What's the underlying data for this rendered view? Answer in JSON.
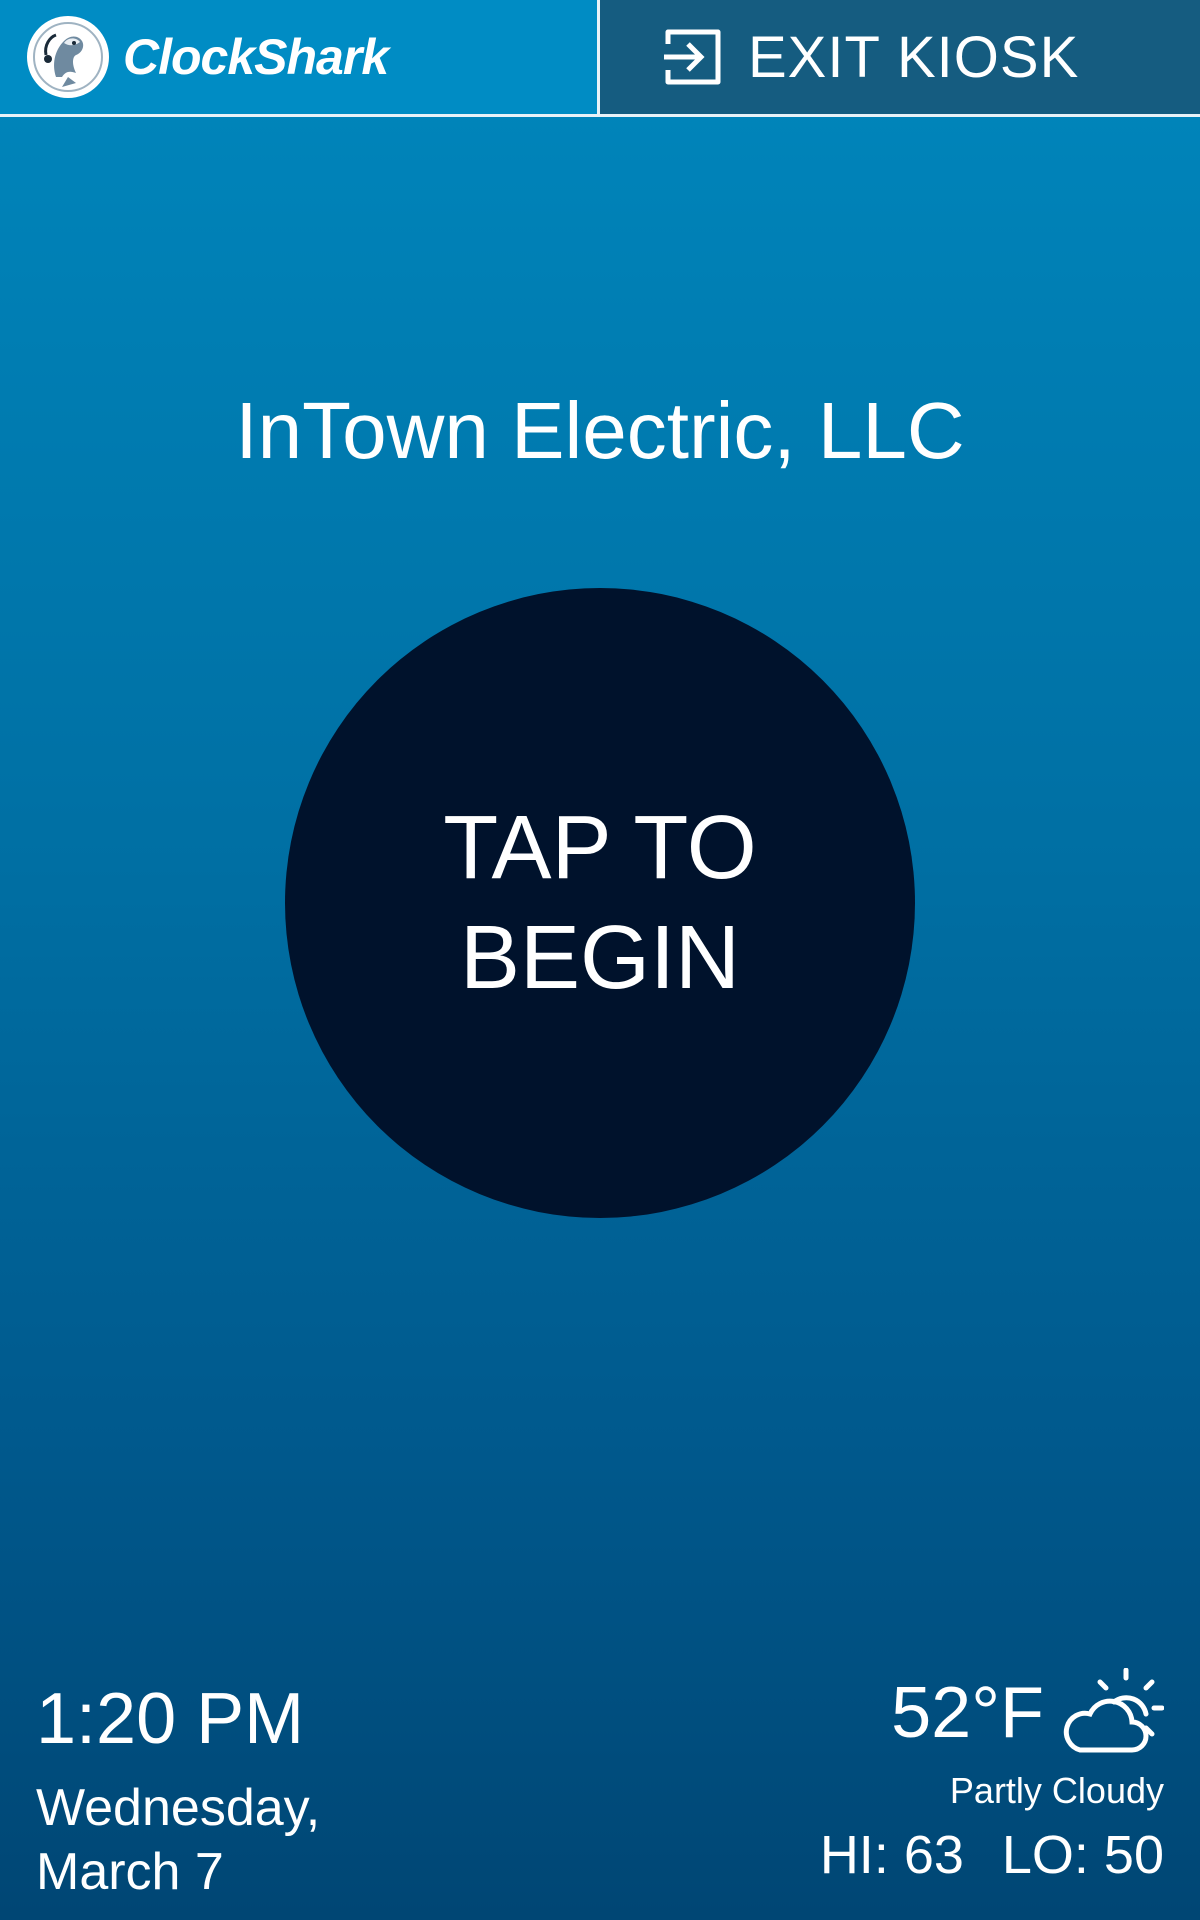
{
  "header": {
    "brand_name": "ClockShark",
    "exit_label": "EXIT KIOSK"
  },
  "company": {
    "name": "InTown Electric, LLC"
  },
  "start": {
    "label": "TAP TO BEGIN"
  },
  "clock": {
    "time": "1:20 PM",
    "date": "Wednesday, March 7"
  },
  "weather": {
    "temperature": "52°F",
    "condition": "Partly Cloudy",
    "high": "HI: 63",
    "low": "LO: 50",
    "icon": "partly-cloudy-icon"
  },
  "colors": {
    "header_brand_bg": "#008cc4",
    "header_exit_bg": "#155c80",
    "button_bg": "#00122c",
    "text": "#ffffff"
  }
}
